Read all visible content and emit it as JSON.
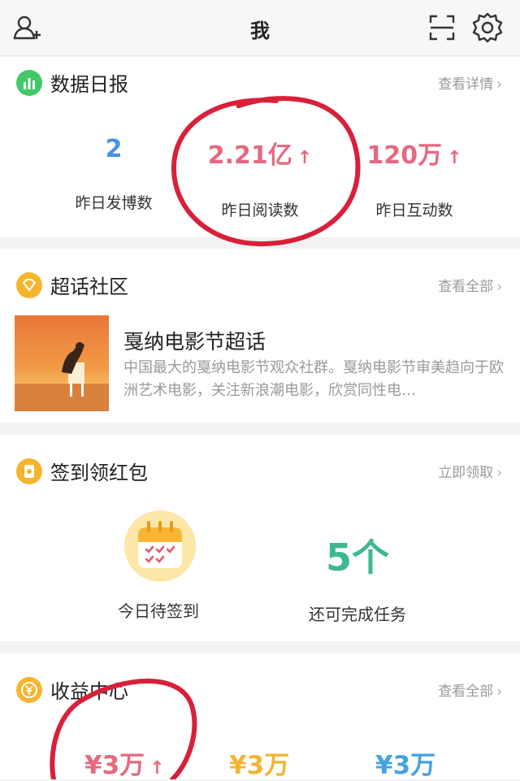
{
  "header": {
    "title": "我"
  },
  "icons": {
    "add_friend": "add-friend-icon",
    "scan": "scan-icon",
    "settings": "gear-icon"
  },
  "data_report": {
    "title": "数据日报",
    "more": "查看详情",
    "stats": [
      {
        "value": "2",
        "label": "昨日发博数"
      },
      {
        "value": "2.21亿",
        "label": "昨日阅读数",
        "trend": "↑"
      },
      {
        "value": "120万",
        "label": "昨日互动数",
        "trend": "↑"
      }
    ]
  },
  "super_topic": {
    "title": "超话社区",
    "more": "查看全部",
    "item": {
      "name": "戛纳电影节超话",
      "desc": "中国最大的戛纳电影节观众社群。戛纳电影节审美趋向于欧洲艺术电影，关注新浪潮电影，欣赏同性电…"
    }
  },
  "sign_in": {
    "title": "签到领红包",
    "more": "立即领取",
    "today_label": "今日待签到",
    "tasks_value": "5个",
    "tasks_label": "还可完成任务"
  },
  "income": {
    "title": "收益中心",
    "more": "查看全部",
    "values": [
      {
        "value": "¥3万",
        "trend": "↑"
      },
      {
        "value": "¥3万"
      },
      {
        "value": "¥3万"
      }
    ]
  },
  "colors": {
    "accent_blue": "#4a90e2",
    "accent_pink": "#e5697f",
    "accent_green": "#3fb88f",
    "accent_gold": "#f2b532",
    "annotation_red": "#d8203b"
  }
}
